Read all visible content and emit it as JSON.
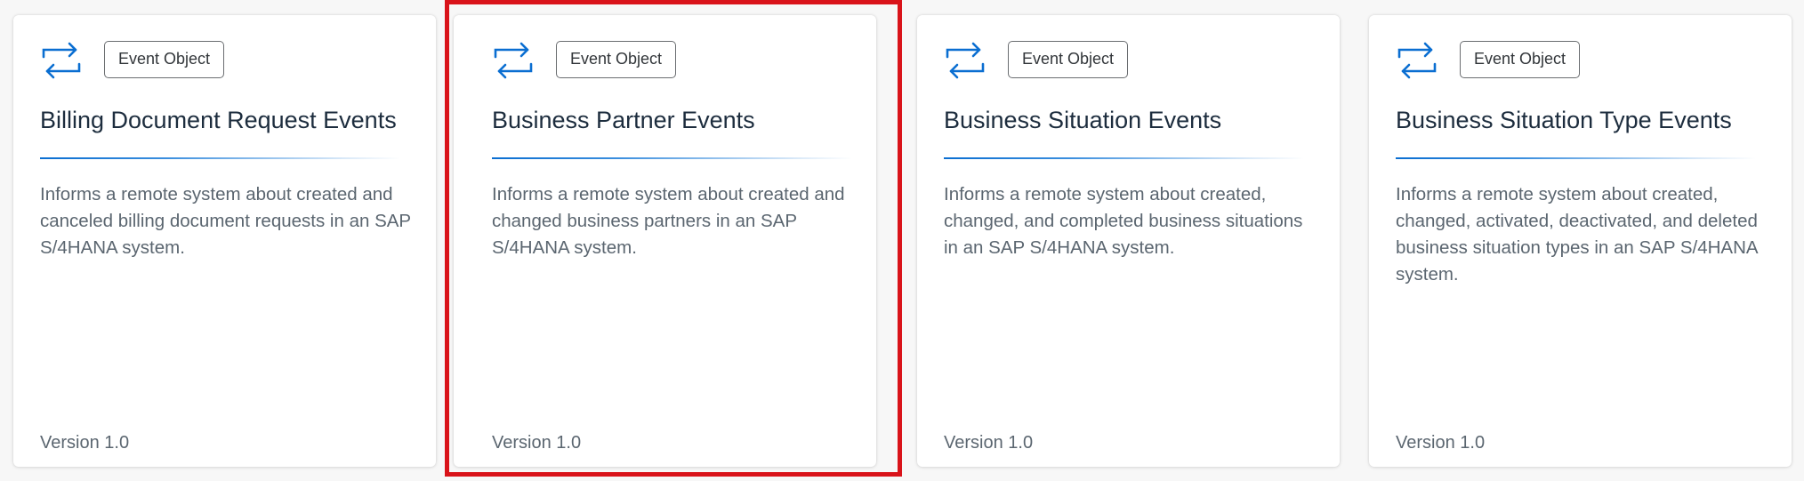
{
  "cards": [
    {
      "icon": "sync-arrows-icon",
      "badge": "Event Object",
      "title": "Billing Document Request Events",
      "description": "Informs a remote system about created and canceled billing document requests in an SAP S/4HANA system.",
      "version": "Version 1.0"
    },
    {
      "icon": "sync-arrows-icon",
      "badge": "Event Object",
      "title": "Business Partner Events",
      "description": "Informs a remote system about created and changed business partners in an SAP S/4HANA system.",
      "version": "Version 1.0"
    },
    {
      "icon": "sync-arrows-icon",
      "badge": "Event Object",
      "title": "Business Situation Events",
      "description": "Informs a remote system about created, changed, and completed business situations in an SAP S/4HANA system.",
      "version": "Version 1.0"
    },
    {
      "icon": "sync-arrows-icon",
      "badge": "Event Object",
      "title": "Business Situation Type Events",
      "description": "Informs a remote system about created, changed, activated, deactivated, and deleted business situation types in an SAP S/4HANA system.",
      "version": "Version 1.0"
    }
  ],
  "colors": {
    "accent": "#0a6ed1",
    "highlight": "#d9131a",
    "title": "#1d2d3e",
    "body_text": "#5b6670"
  }
}
